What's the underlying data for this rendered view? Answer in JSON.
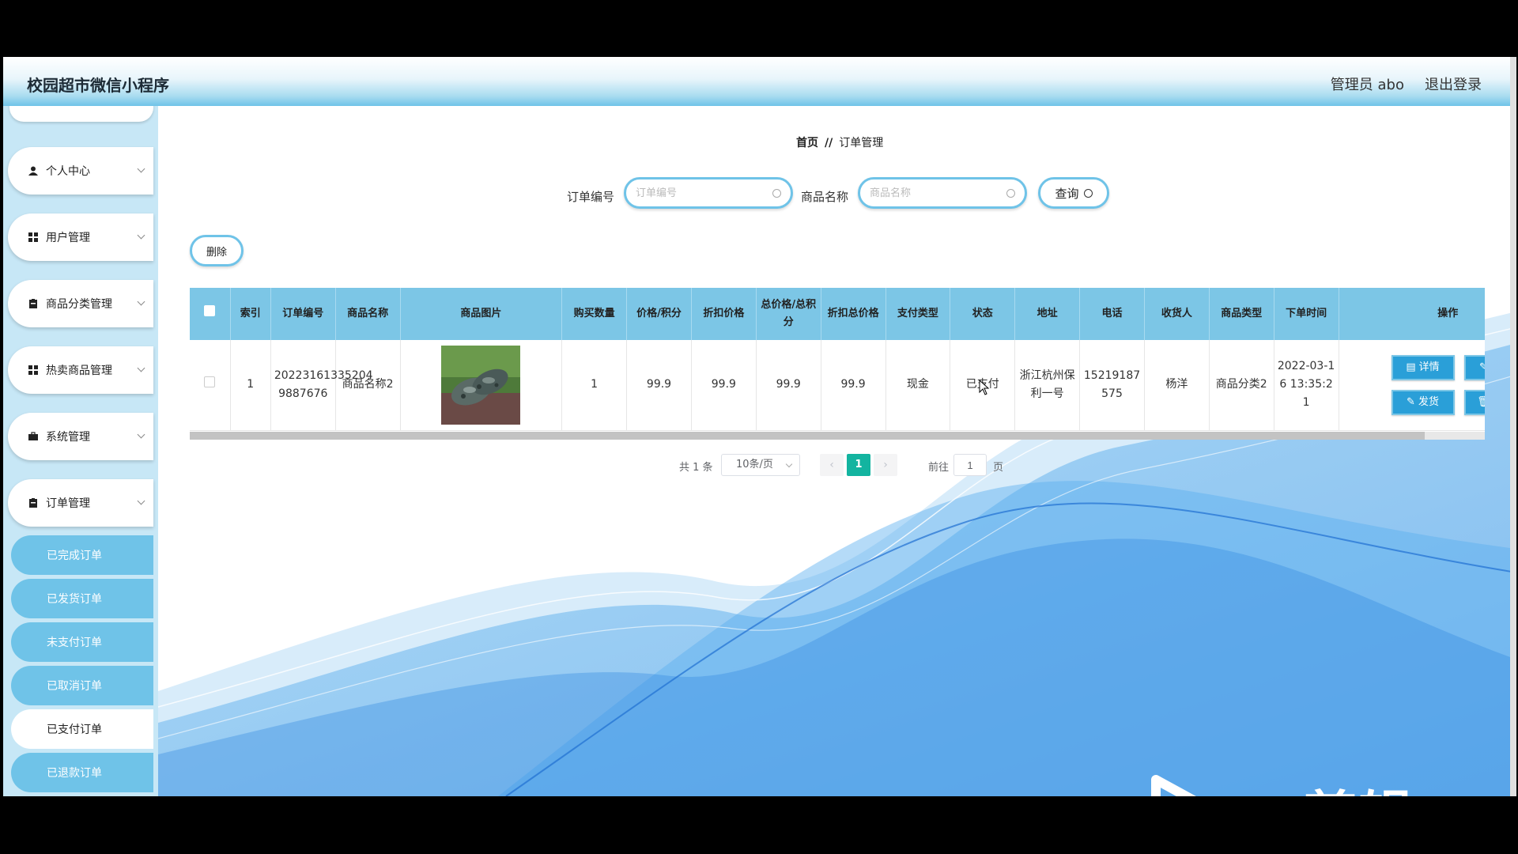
{
  "header": {
    "title": "校园超市微信小程序",
    "admin_label": "管理员 abo",
    "logout_label": "退出登录"
  },
  "sidebar": {
    "items": [
      {
        "label": "个人中心",
        "icon": "user-icon"
      },
      {
        "label": "用户管理",
        "icon": "grid-icon"
      },
      {
        "label": "商品分类管理",
        "icon": "clipboard-icon"
      },
      {
        "label": "热卖商品管理",
        "icon": "grid-icon"
      },
      {
        "label": "系统管理",
        "icon": "briefcase-icon"
      },
      {
        "label": "订单管理",
        "icon": "clipboard-icon"
      }
    ],
    "sub_items": [
      {
        "label": "已完成订单",
        "active": false
      },
      {
        "label": "已发货订单",
        "active": false
      },
      {
        "label": "未支付订单",
        "active": false
      },
      {
        "label": "已取消订单",
        "active": false
      },
      {
        "label": "已支付订单",
        "active": true
      },
      {
        "label": "已退款订单",
        "active": false
      }
    ]
  },
  "breadcrumb": {
    "home": "首页",
    "separator": "//",
    "current": "订单管理"
  },
  "search": {
    "order_no_label": "订单编号",
    "order_no_placeholder": "订单编号",
    "product_name_label": "商品名称",
    "product_name_placeholder": "商品名称",
    "query_label": "查询"
  },
  "toolbar": {
    "delete_label": "删除"
  },
  "table": {
    "headers": [
      "索引",
      "订单编号",
      "商品名称",
      "商品图片",
      "购买数量",
      "价格/积分",
      "折扣价格",
      "总价格/总积分",
      "折扣总价格",
      "支付类型",
      "状态",
      "地址",
      "电话",
      "收货人",
      "商品类型",
      "下单时间",
      "操作"
    ],
    "rows": [
      {
        "index": "1",
        "order_no": "20223161335204 9887676",
        "product_name": "商品名称2",
        "quantity": "1",
        "price": "99.9",
        "discount_price": "99.9",
        "total_price": "99.9",
        "discount_total": "99.9",
        "pay_type": "现金",
        "status": "已支付",
        "address": "浙江杭州保利一号",
        "phone": "15219187575",
        "receiver": "杨洋",
        "category": "商品分类2",
        "order_time": "2022-03-16 13:35:21"
      }
    ],
    "actions": {
      "detail": "详情",
      "edit": "修改",
      "ship": "发货",
      "delete": "删除"
    }
  },
  "pagination": {
    "total_text": "共 1 条",
    "page_size": "10条/页",
    "current_page": "1",
    "goto_label": "前往",
    "goto_value": "1",
    "page_suffix": "页"
  },
  "watermark": {
    "text": "ev剪辑"
  }
}
